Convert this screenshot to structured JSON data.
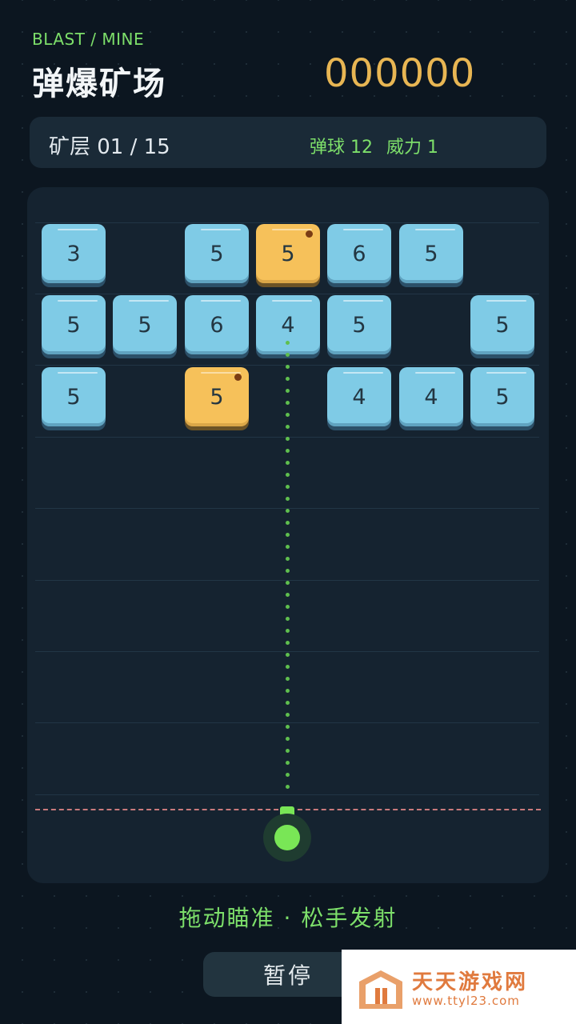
{
  "header": {
    "subtitle": "BLAST / MINE",
    "title": "弹爆矿场",
    "score": "000000"
  },
  "status": {
    "level": "矿层 01 / 15",
    "balls": "弹球 12",
    "power": "威力 1"
  },
  "board": {
    "rows": [
      [
        "3",
        "",
        "5",
        "5",
        "6",
        "5",
        ""
      ],
      [
        "5",
        "5",
        "6",
        "4",
        "5",
        "",
        "5"
      ],
      [
        "5",
        "",
        "5",
        "",
        "4",
        "4",
        "5"
      ]
    ],
    "gold_cells": [
      [
        0,
        3
      ],
      [
        2,
        2
      ]
    ]
  },
  "hint": "拖动瞄准 · 松手发射",
  "pause_label": "暂停",
  "watermark": {
    "name": "天天游戏网",
    "url": "www.ttyl23.com"
  },
  "colors": {
    "background": "#0c1620",
    "accent_green": "#7ddf6a",
    "score_gold": "#e8b653",
    "block_blue": "#7fcbe6",
    "block_gold": "#f6c15a",
    "danger_line": "#c97a7c"
  }
}
